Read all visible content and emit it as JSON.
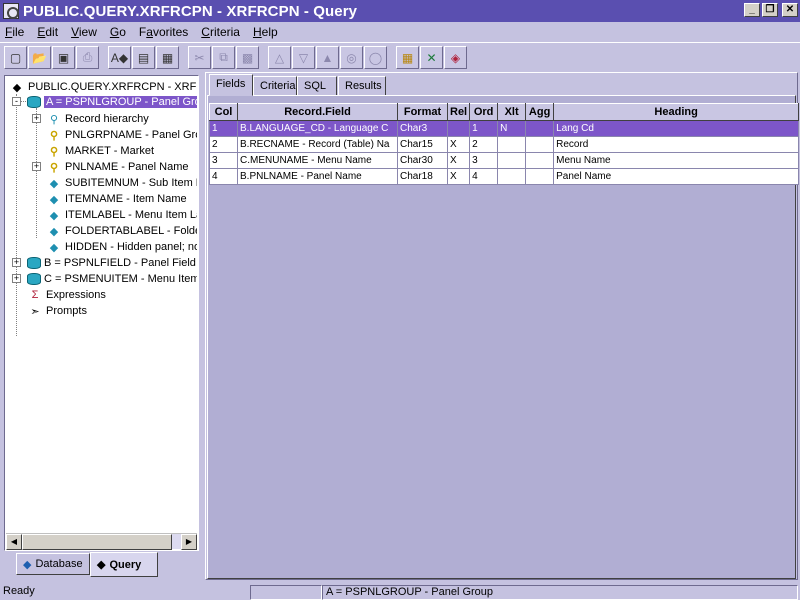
{
  "window": {
    "title": "PUBLIC.QUERY.XRFRCPN - XRFRCPN - Query",
    "minimize_glyph": "_",
    "restore_glyph": "❐",
    "close_glyph": "✕"
  },
  "menu": {
    "items": [
      {
        "accel": "F",
        "rest": "ile"
      },
      {
        "accel": "E",
        "rest": "dit"
      },
      {
        "accel": "V",
        "rest": "iew"
      },
      {
        "accel": "G",
        "rest": "o"
      },
      {
        "accel": "",
        "pre": "F",
        "accel2": "a",
        "rest": "vorites"
      },
      {
        "accel": "C",
        "rest": "riteria"
      },
      {
        "accel": "H",
        "rest": "elp"
      }
    ]
  },
  "toolbar": {
    "icons": [
      "new-icon",
      "open-icon",
      "save-icon",
      "print-icon",
      "find-replace-icon",
      "properties-icon",
      "options-icon",
      "cut-icon",
      "copy-icon",
      "paste-icon",
      "add-criteria-icon",
      "delete-criteria-icon",
      "having-icon",
      "in-list-icon",
      "expressions-icon",
      "run-icon",
      "excel-icon",
      "crystal-icon"
    ]
  },
  "tree": {
    "root": "PUBLIC.QUERY.XRFRCPN - XRFRC",
    "record_a": "A = PSPNLGROUP - Panel Grou",
    "record_hierarchy": "Record hierarchy",
    "fields_a": [
      "PNLGRPNAME - Panel Grou",
      "MARKET - Market",
      "PNLNAME - Panel Name",
      "SUBITEMNUM - Sub Item Nu",
      "ITEMNAME - Item Name",
      "ITEMLABEL - Menu Item La",
      "FOLDERTABLABEL - Folde",
      "HIDDEN - Hidden panel; not"
    ],
    "record_b": "B = PSPNLFIELD - Panel Field",
    "record_c": "C = PSMENUITEM - Menu Item",
    "expressions": "Expressions",
    "prompts": "Prompts"
  },
  "left_tabs": {
    "database": "Database",
    "query": "Query"
  },
  "right_tabs": [
    "Fields",
    "Criteria",
    "SQL",
    "Results"
  ],
  "grid": {
    "columns": [
      "Col",
      "Record.Field",
      "Format",
      "Rel",
      "Ord",
      "Xlt",
      "Agg",
      "Heading"
    ],
    "rows": [
      {
        "col": "1",
        "field": "B.LANGUAGE_CD - Language C",
        "format": "Char3",
        "rel": "",
        "ord": "1",
        "xlt": "N",
        "agg": "",
        "heading": "Lang Cd"
      },
      {
        "col": "2",
        "field": "B.RECNAME - Record (Table) Na",
        "format": "Char15",
        "rel": "X",
        "ord": "2",
        "xlt": "",
        "agg": "",
        "heading": "Record"
      },
      {
        "col": "3",
        "field": "C.MENUNAME - Menu Name",
        "format": "Char30",
        "rel": "X",
        "ord": "3",
        "xlt": "",
        "agg": "",
        "heading": "Menu Name"
      },
      {
        "col": "4",
        "field": "B.PNLNAME - Panel Name",
        "format": "Char18",
        "rel": "X",
        "ord": "4",
        "xlt": "",
        "agg": "",
        "heading": "Panel Name"
      }
    ]
  },
  "status": {
    "left": "Ready",
    "middle": "",
    "right": "A = PSPNLGROUP - Panel Group"
  }
}
